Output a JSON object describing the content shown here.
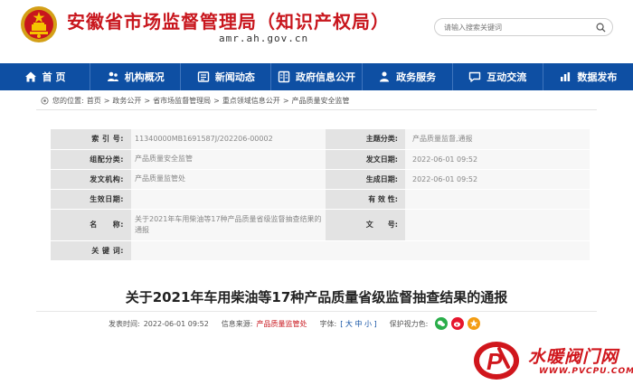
{
  "site": {
    "title": "安徽省市场监督管理局（知识产权局）",
    "domain": "amr.ah.gov.cn"
  },
  "search": {
    "placeholder": "请输入搜索关键词"
  },
  "nav": {
    "items": [
      {
        "label": "首 页",
        "icon": "home-icon"
      },
      {
        "label": "机构概况",
        "icon": "people-icon"
      },
      {
        "label": "新闻动态",
        "icon": "news-icon"
      },
      {
        "label": "政府信息公开",
        "icon": "info-icon"
      },
      {
        "label": "政务服务",
        "icon": "service-icon"
      },
      {
        "label": "互动交流",
        "icon": "chat-icon"
      },
      {
        "label": "数据发布",
        "icon": "chart-icon"
      }
    ]
  },
  "breadcrumb": {
    "prefix": "您的位置:",
    "items": [
      "首页",
      "政务公开",
      "省市场监督管理局",
      "重点领域信息公开",
      "产品质量安全监管"
    ],
    "separator": ">"
  },
  "info": {
    "index_label": "索 引 号:",
    "index_value": "11340000MB1691587J/202206-00002",
    "topic_label": "主题分类:",
    "topic_value": "产品质量监督,通报",
    "group_label": "组配分类:",
    "group_value": "产品质量安全监管",
    "pubdate_label": "发文日期:",
    "pubdate_value": "2022-06-01 09:52",
    "issuer_label": "发文机构:",
    "issuer_value": "产品质量监管处",
    "gendate_label": "生成日期:",
    "gendate_value": "2022-06-01 09:52",
    "effective_label": "生效日期:",
    "effective_value": "",
    "validity_label": "有 效 性:",
    "validity_value": "",
    "name_label": "名　　称:",
    "name_value": "关于2021年车用柴油等17种产品质量省级监督抽查结果的通报",
    "docno_label": "文　　号:",
    "docno_value": "",
    "keywords_label": "关 键 词:",
    "keywords_value": ""
  },
  "article": {
    "title": "关于2021年车用柴油等17种产品质量省级监督抽查结果的通报",
    "time_label": "发表时间:",
    "time_value": "2022-06-01 09:52",
    "source_label": "信息来源:",
    "source_value": "产品质量监管处",
    "font_label": "字体:",
    "font_value": "[ 大 中 小 ]",
    "protect_label": "保护视力色:"
  },
  "watermark": {
    "text": "水暖阀门网",
    "url": "WWW.PVCPU.COM"
  },
  "colors": {
    "brand_red": "#c8161d",
    "nav_blue": "#0e4fa3"
  }
}
